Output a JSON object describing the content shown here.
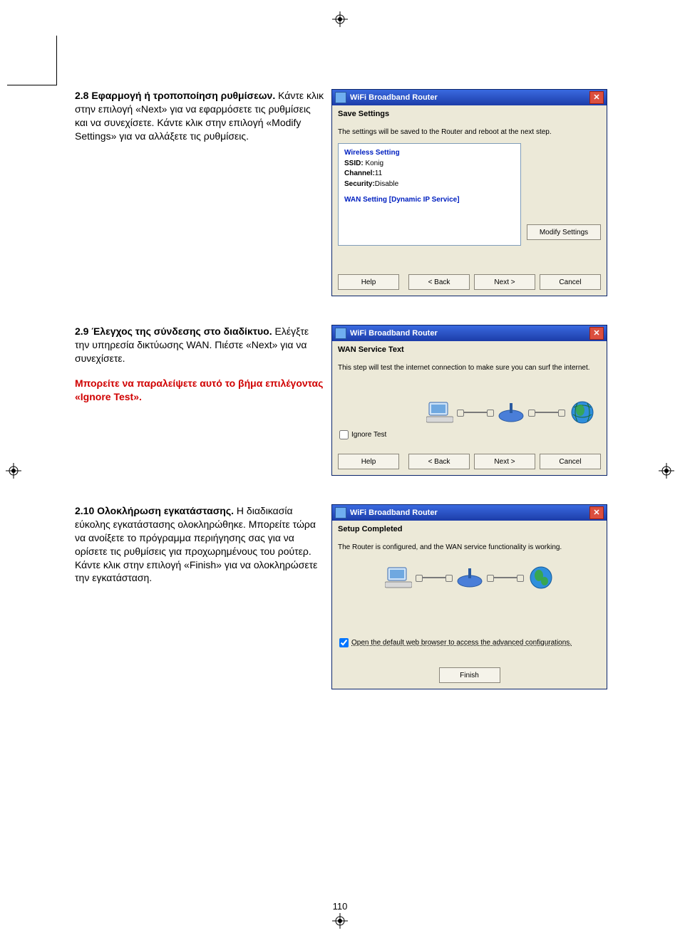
{
  "page_number": "110",
  "sections": {
    "s28": {
      "heading": "2.8 Εφαρμογή ή τροποποίηση ρυθμίσεων.",
      "body": "Κάντε κλικ στην επιλογή «Next» για να εφαρμόσετε τις ρυθμίσεις και να συνεχίσετε. Κάντε κλικ στην επιλογή «Modify Settings» για να αλλάξετε τις ρυθμίσεις."
    },
    "s29": {
      "heading": "2.9 Έλεγχος της σύνδεσης στο διαδίκτυο.",
      "body": "Ελέγξτε την υπηρεσία δικτύωσης WAN. Πιέστε «Next» για να συνεχίσετε.",
      "warn": "Μπορείτε να παραλείψετε αυτό το βήμα επιλέγοντας «Ignore Test»."
    },
    "s210": {
      "heading": "2.10 Ολοκλήρωση εγκατάστασης.",
      "body": "Η διαδικασία εύκολης εγκατάστασης ολοκληρώθηκε. Μπορείτε τώρα να ανοίξετε το πρόγραμμα περιήγησης σας για να ορίσετε τις ρυθμίσεις για προχωρημένους του ρούτερ. Κάντε κλικ στην επιλογή «Finish» για να ολοκληρώσετε την εγκατάσταση."
    }
  },
  "dialog1": {
    "title": "WiFi Broadband Router",
    "subtitle": "Save Settings",
    "msg": "The settings will be saved to the Router and reboot at the next step.",
    "wireless_heading": "Wireless Setting",
    "ssid_label": "SSID:",
    "ssid_value": "Konig",
    "channel_label": "Channel:",
    "channel_value": "11",
    "security_label": "Security:",
    "security_value": "Disable",
    "wan_heading": "WAN Setting  [Dynamic IP Service]",
    "modify": "Modify Settings",
    "help": "Help",
    "back": "< Back",
    "next": "Next >",
    "cancel": "Cancel"
  },
  "dialog2": {
    "title": "WiFi Broadband Router",
    "subtitle": "WAN Service Text",
    "msg": "This step will test the internet connection to make sure you can surf the internet.",
    "ignore": "Ignore Test",
    "help": "Help",
    "back": "< Back",
    "next": "Next >",
    "cancel": "Cancel"
  },
  "dialog3": {
    "title": "WiFi Broadband Router",
    "subtitle": "Setup Completed",
    "msg": "The Router is configured, and the WAN service functionality is working.",
    "openbrowser": "Open the default web browser to access the advanced configurations.",
    "finish": "Finish"
  }
}
